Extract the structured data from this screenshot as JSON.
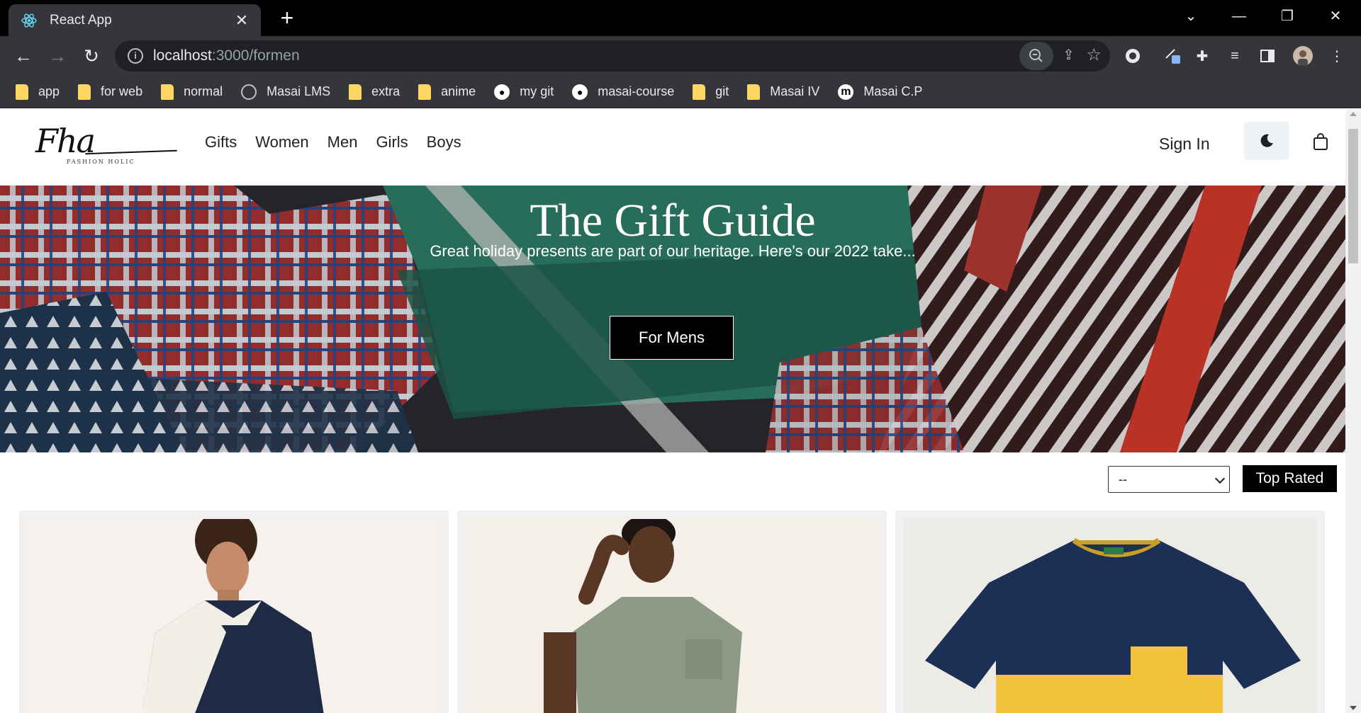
{
  "browser": {
    "tab_title": "React App",
    "url_host": "localhost",
    "url_path": ":3000/formen",
    "bookmarks": [
      {
        "label": "app",
        "icon": "folder-icon"
      },
      {
        "label": "for web",
        "icon": "folder-icon"
      },
      {
        "label": "normal",
        "icon": "folder-icon"
      },
      {
        "label": "Masai LMS",
        "icon": "globe-icon"
      },
      {
        "label": "extra",
        "icon": "folder-icon"
      },
      {
        "label": "anime",
        "icon": "folder-icon"
      },
      {
        "label": "my git",
        "icon": "github-icon"
      },
      {
        "label": "masai-course",
        "icon": "github-icon"
      },
      {
        "label": "git",
        "icon": "folder-icon"
      },
      {
        "label": "Masai IV",
        "icon": "folder-icon"
      },
      {
        "label": "Masai C.P",
        "icon": "masai-m-icon"
      }
    ]
  },
  "site": {
    "nav": [
      "Gifts",
      "Women",
      "Men",
      "Girls",
      "Boys"
    ],
    "sign_in": "Sign In",
    "hero": {
      "title": "The Gift Guide",
      "subtitle": "Great holiday presents are part of our heritage. Here's our 2022 take...",
      "button": "For Mens"
    },
    "sort": {
      "selected": "--",
      "top_rated_label": "Top Rated"
    }
  },
  "colors": {
    "chrome_dark": "#000000",
    "chrome_toolbar": "#35363a",
    "accent_button": "#000000",
    "theme_toggle_bg": "#edf2f7",
    "card_bg": "#f0f0f0"
  }
}
